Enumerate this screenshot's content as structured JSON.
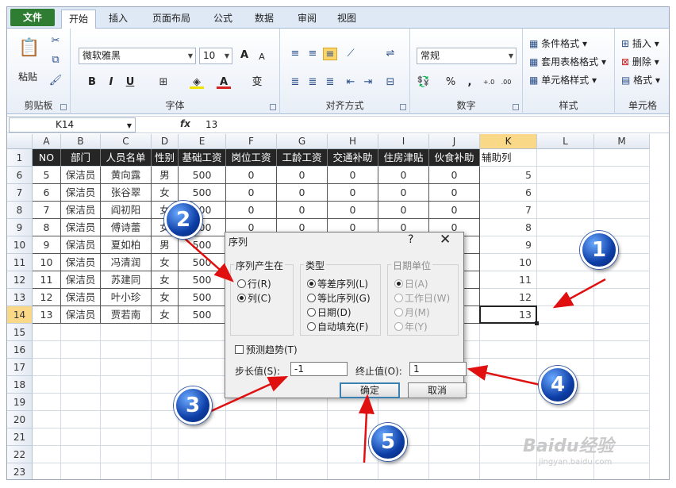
{
  "tabs": [
    "文件",
    "开始",
    "插入",
    "页面布局",
    "公式",
    "数据",
    "审阅",
    "视图"
  ],
  "ribbon": {
    "clipboard": {
      "paste": "粘贴",
      "label": "剪贴板"
    },
    "font": {
      "name": "微软雅黑",
      "size": "10",
      "label": "字体",
      "bold": "B",
      "italic": "I",
      "underline": "U",
      "grow": "A",
      "shrink": "A",
      "phonetic": "变"
    },
    "alignment": {
      "label": "对齐方式"
    },
    "number": {
      "format": "常规",
      "label": "数字",
      "percent": "%",
      "comma": ",",
      "inc": "+.0 .00",
      "dec": ".00 →.0"
    },
    "styles": {
      "cond": "条件格式",
      "table": "套用表格格式",
      "cell": "单元格样式",
      "label": "样式"
    },
    "cells": {
      "insert": "插入",
      "delete": "删除",
      "format": "格式",
      "label": "单元格"
    }
  },
  "formula_bar": {
    "name_box": "K14",
    "fx": "fx",
    "value": "13"
  },
  "columns": [
    "A",
    "B",
    "C",
    "D",
    "E",
    "F",
    "G",
    "H",
    "I",
    "J",
    "K",
    "L",
    "M"
  ],
  "row_numbers": [
    "1",
    "6",
    "7",
    "8",
    "9",
    "10",
    "11",
    "12",
    "13",
    "14",
    "15",
    "16",
    "17",
    "18",
    "19",
    "20",
    "21",
    "22",
    "23"
  ],
  "headers": [
    "NO",
    "部门",
    "人员名单",
    "性别",
    "基础工资",
    "岗位工资",
    "工龄工资",
    "交通补助",
    "住房津贴",
    "伙食补助",
    "辅助列"
  ],
  "rows": [
    [
      "5",
      "保洁员",
      "黄向露",
      "男",
      "500",
      "0",
      "0",
      "0",
      "0",
      "0",
      "5"
    ],
    [
      "6",
      "保洁员",
      "张谷翠",
      "女",
      "500",
      "0",
      "0",
      "0",
      "0",
      "0",
      "6"
    ],
    [
      "7",
      "保洁员",
      "阎初阳",
      "女",
      "500",
      "0",
      "0",
      "0",
      "0",
      "0",
      "7"
    ],
    [
      "8",
      "保洁员",
      "傅诗蕾",
      "女",
      "500",
      "0",
      "0",
      "0",
      "0",
      "0",
      "8"
    ],
    [
      "9",
      "保洁员",
      "夏如柏",
      "男",
      "500",
      "",
      "",
      "",
      "",
      "",
      "9"
    ],
    [
      "10",
      "保洁员",
      "冯清润",
      "女",
      "500",
      "",
      "",
      "",
      "",
      "",
      "10"
    ],
    [
      "11",
      "保洁员",
      "苏建同",
      "女",
      "500",
      "",
      "",
      "",
      "",
      "",
      "11"
    ],
    [
      "12",
      "保洁员",
      "叶小珍",
      "女",
      "500",
      "",
      "",
      "",
      "",
      "",
      "12"
    ],
    [
      "13",
      "保洁员",
      "贾若南",
      "女",
      "500",
      "",
      "",
      "",
      "",
      "",
      "13"
    ]
  ],
  "dialog": {
    "title": "序列",
    "help": "?",
    "close": "✕",
    "series_in": {
      "legend": "序列产生在",
      "row": "行(R)",
      "col": "列(C)"
    },
    "type": {
      "legend": "类型",
      "linear": "等差序列(L)",
      "growth": "等比序列(G)",
      "date": "日期(D)",
      "autofill": "自动填充(F)"
    },
    "date_unit": {
      "legend": "日期单位",
      "day": "日(A)",
      "weekday": "工作日(W)",
      "month": "月(M)",
      "year": "年(Y)"
    },
    "trend": "预测趋势(T)",
    "step_label": "步长值(S):",
    "step_value": "-1",
    "stop_label": "终止值(O):",
    "stop_value": "1",
    "ok": "确定",
    "cancel": "取消"
  },
  "annotations": [
    "1",
    "2",
    "3",
    "4",
    "5"
  ],
  "watermark": {
    "brand": "Baidu经验",
    "url": "jingyan.baidu.com"
  }
}
